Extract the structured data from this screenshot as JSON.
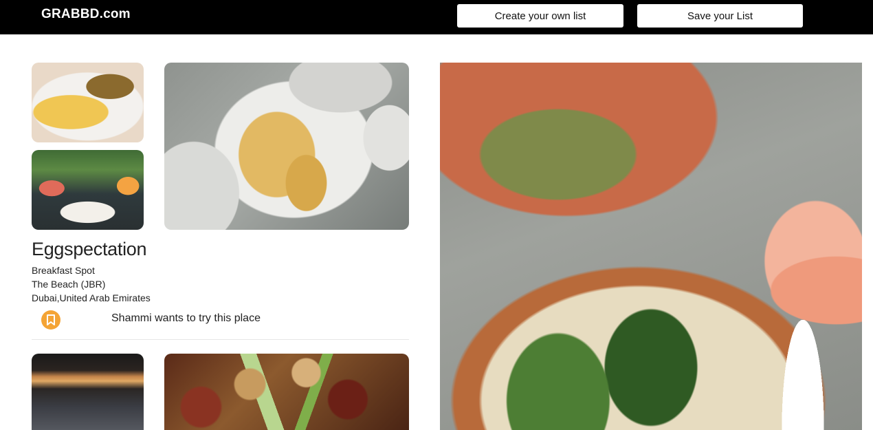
{
  "header": {
    "brand": "GRABBD.com",
    "create_label": "Create your own list",
    "save_label": "Save your List"
  },
  "place": {
    "name": "Eggspectation",
    "category": "Breakfast Spot",
    "area": "The Beach (JBR)",
    "location": "Dubai,United Arab Emirates",
    "want_to_try": "Shammi wants to try this place",
    "bookmark_icon": "bookmark-icon",
    "accent_color": "#f4a435"
  },
  "colors": {
    "header_bg": "#000000",
    "page_bg": "#ffffff"
  }
}
